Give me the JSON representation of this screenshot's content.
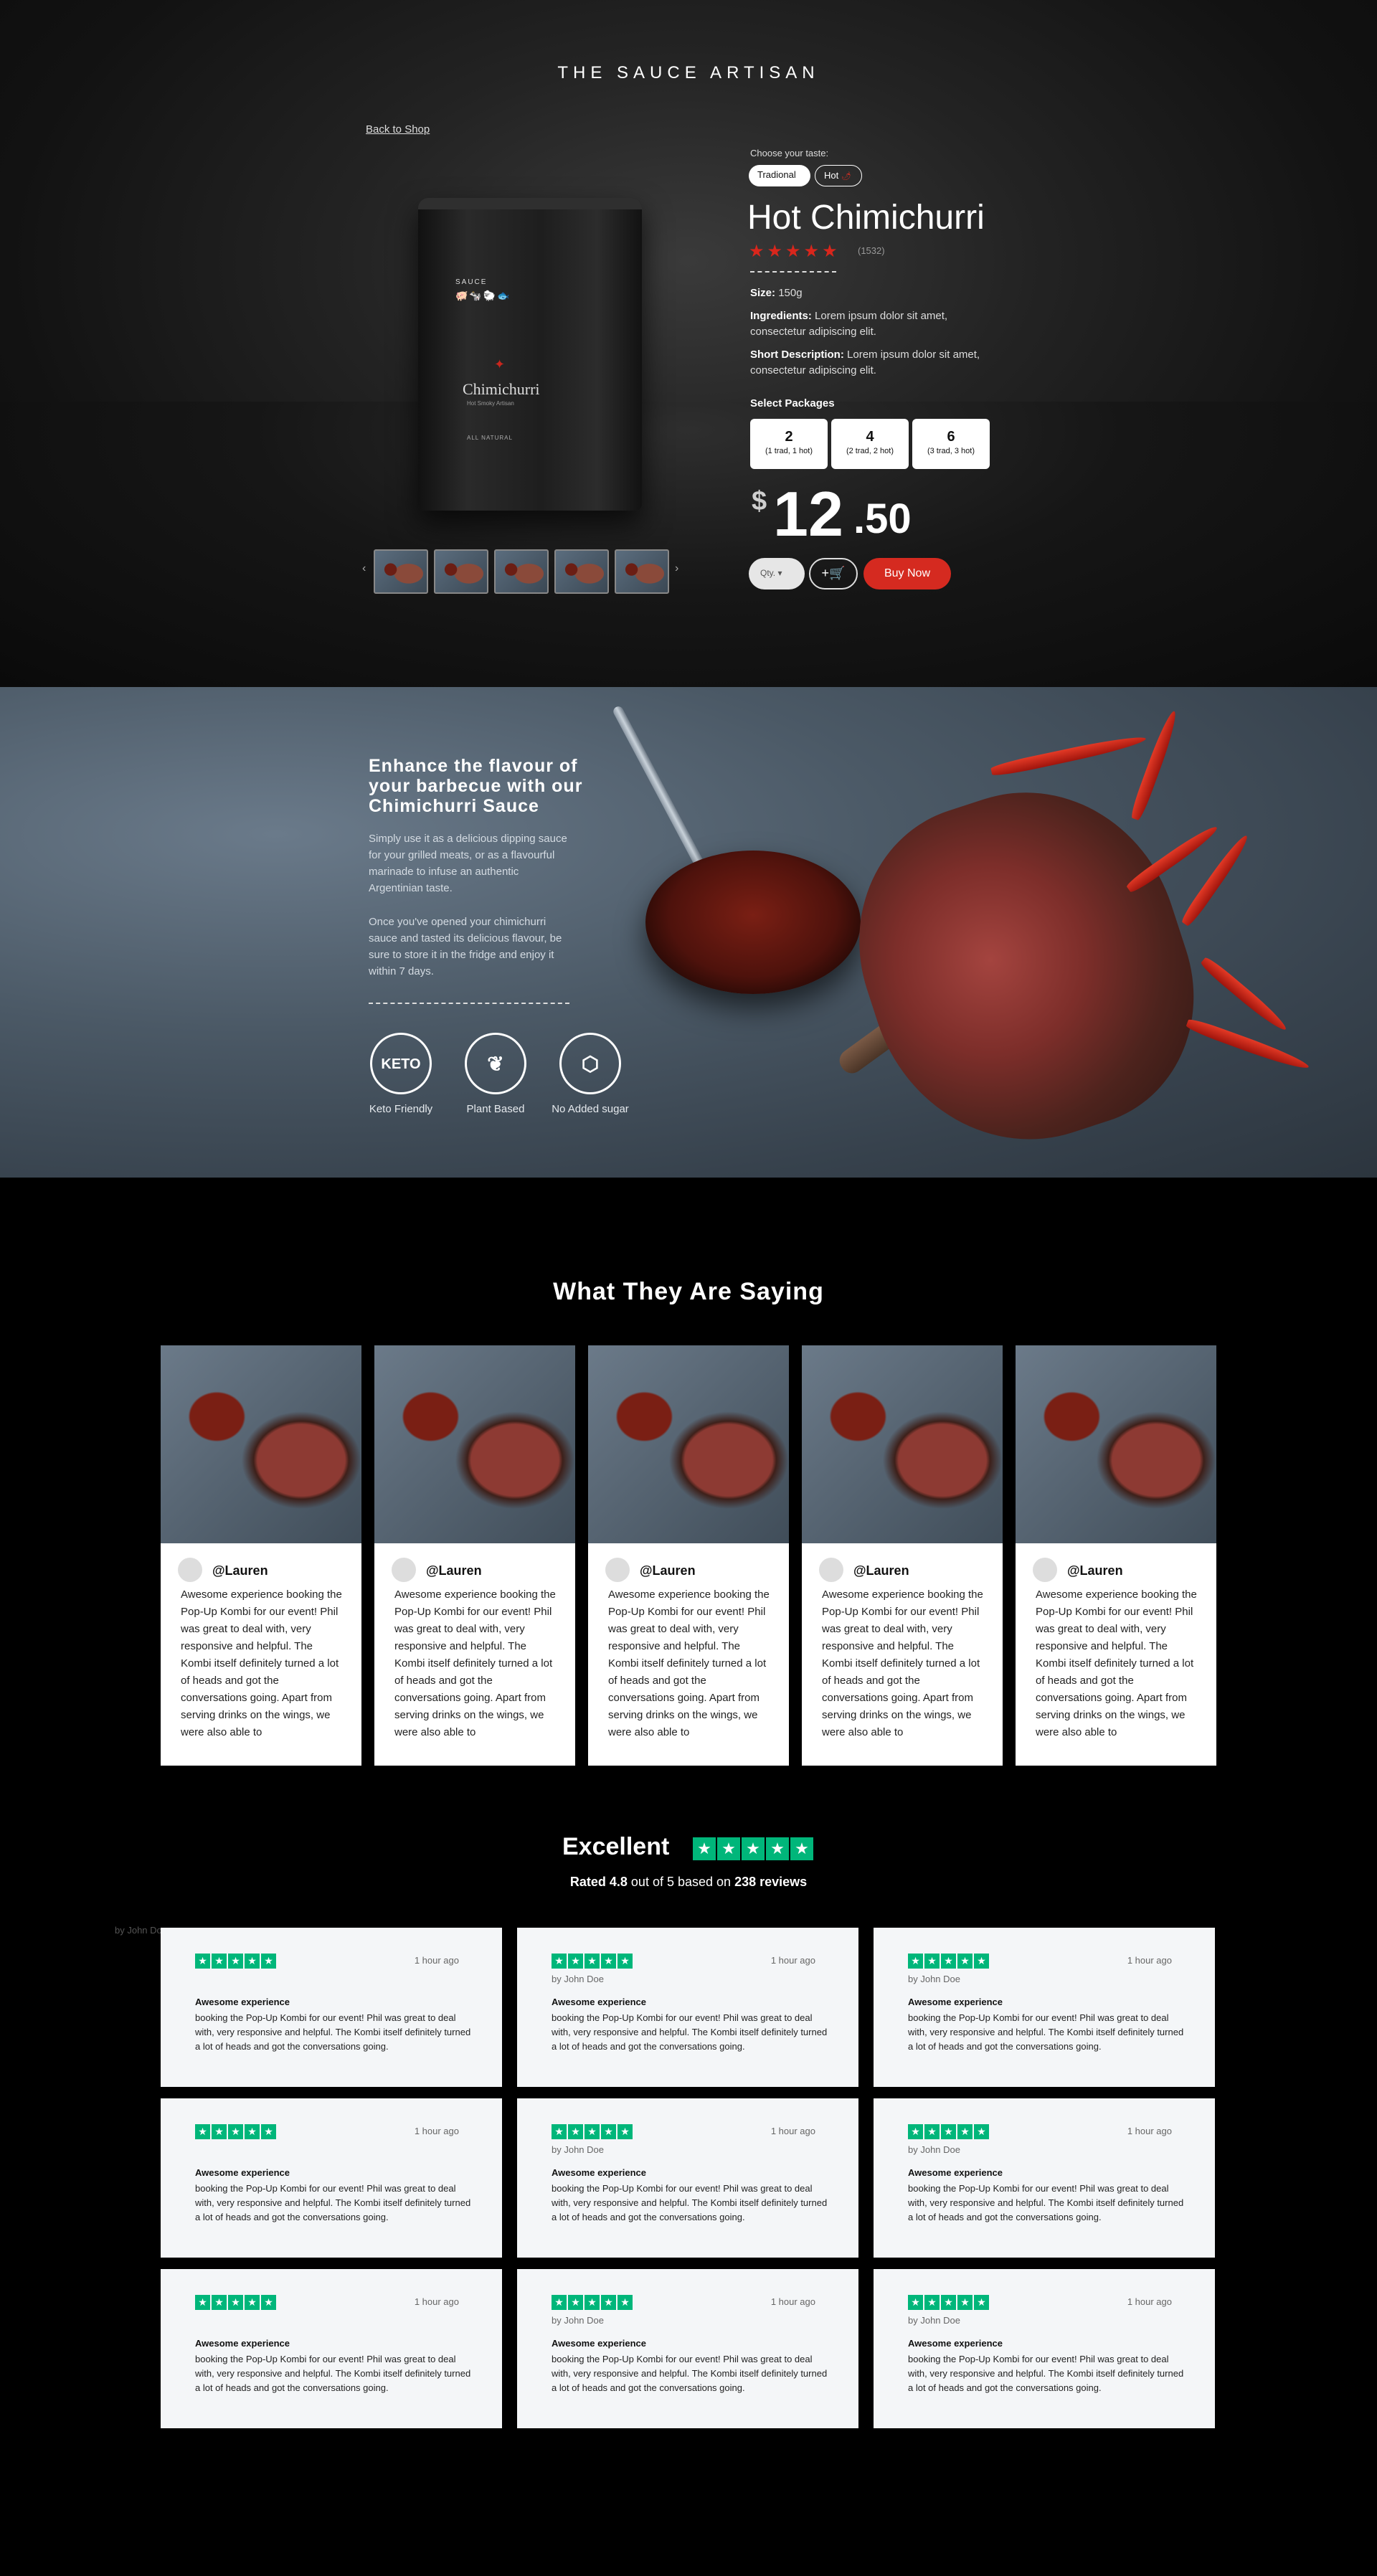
{
  "header": {
    "brand": "THE SAUCE ARTISAN",
    "back_link": "Back to Shop"
  },
  "packshot": {
    "sauce_label": "SAUCE",
    "animals": "🐖🐄🐑🐟",
    "name": "Chimichurri",
    "subtitle": "Hot Smoky Artisan",
    "natural": "ALL NATURAL"
  },
  "product": {
    "taste_label": "Choose your taste:",
    "tastes": [
      "Tradional",
      "Hot"
    ],
    "title": "Hot Chimichurri",
    "rating_stars": "★★★★★",
    "rating_count": "(1532)",
    "size_label": "Size:",
    "size_value": "150g",
    "ingredients_label": "Ingredients:",
    "ingredients_value": "Lorem ipsum dolor sit amet, consectetur adipiscing elit.",
    "short_label": "Short Description:",
    "short_value": "Lorem ipsum dolor sit amet, consectetur adipiscing elit.",
    "packages_label": "Select Packages",
    "packages": [
      {
        "n": "2",
        "d": "(1 trad, 1 hot)"
      },
      {
        "n": "4",
        "d": "(2 trad, 2 hot)"
      },
      {
        "n": "6",
        "d": "(3 trad, 3 hot)"
      }
    ],
    "price_currency": "$",
    "price_whole": "12",
    "price_cents": ".50",
    "qty_label": "Qty.",
    "qty_arrow": "▾",
    "cart_icon": "+🛒",
    "buy_label": "Buy Now"
  },
  "feature": {
    "title": "Enhance the flavour of your barbecue with our Chimichurri Sauce",
    "p1": "Simply use it as a delicious dipping sauce for your grilled meats, or as a flavourful marinade to infuse an authentic Argentinian taste.",
    "p2": "Once you've opened your chimichurri sauce and tasted its delicious flavour, be sure to store it in the fridge and enjoy it within 7 days.",
    "badges": [
      {
        "glyph": "KETO",
        "label": "Keto Friendly",
        "icon": "keto-icon"
      },
      {
        "glyph": "❦",
        "label": "Plant Based",
        "icon": "leaf-icon"
      },
      {
        "glyph": "⬡",
        "label": "No Added sugar",
        "icon": "sugar-cube-icon"
      }
    ]
  },
  "testimonials": {
    "title": "What They Are Saying",
    "items": [
      {
        "handle": "@Lauren",
        "text": "Awesome experience booking the Pop-Up Kombi for our event! Phil was great to deal with, very responsive and helpful. The Kombi itself definitely turned a lot of heads and got the conversations going. Apart from serving drinks on the wings, we were also able to"
      },
      {
        "handle": "@Lauren",
        "text": "Awesome experience booking the Pop-Up Kombi for our event! Phil was great to deal with, very responsive and helpful. The Kombi itself definitely turned a lot of heads and got the conversations going. Apart from serving drinks on the wings, we were also able to"
      },
      {
        "handle": "@Lauren",
        "text": "Awesome experience booking the Pop-Up Kombi for our event! Phil was great to deal with, very responsive and helpful. The Kombi itself definitely turned a lot of heads and got the conversations going. Apart from serving drinks on the wings, we were also able to"
      },
      {
        "handle": "@Lauren",
        "text": "Awesome experience booking the Pop-Up Kombi for our event! Phil was great to deal with, very responsive and helpful. The Kombi itself definitely turned a lot of heads and got the conversations going. Apart from serving drinks on the wings, we were also able to"
      },
      {
        "handle": "@Lauren",
        "text": "Awesome experience booking the Pop-Up Kombi for our event! Phil was great to deal with, very responsive and helpful. The Kombi itself definitely turned a lot of heads and got the conversations going. Apart from serving drinks on the wings, we were also able to"
      }
    ]
  },
  "reviews": {
    "excellent": "Excellent",
    "rated_prefix": "Rated",
    "rated_score": "4.8",
    "rated_mid": "out of 5 based on",
    "rated_count": "238 reviews",
    "stray_by": "by John Doe",
    "star_glyph": "★",
    "items": [
      {
        "ago": "1 hour ago",
        "by": "",
        "title": "Awesome experience",
        "text": "booking the Pop-Up Kombi for our event! Phil was great to deal with, very responsive and helpful. The Kombi itself definitely turned a lot of heads and got the conversations going."
      },
      {
        "ago": "1 hour ago",
        "by": "by John Doe",
        "title": "Awesome experience",
        "text": "booking the Pop-Up Kombi for our event! Phil was great to deal with, very responsive and helpful. The Kombi itself definitely turned a lot of heads and got the conversations going."
      },
      {
        "ago": "1 hour ago",
        "by": "by John Doe",
        "title": "Awesome experience",
        "text": "booking the Pop-Up Kombi for our event! Phil was great to deal with, very responsive and helpful. The Kombi itself definitely turned a lot of heads and got the conversations going."
      },
      {
        "ago": "1 hour ago",
        "by": "",
        "title": "Awesome experience",
        "text": "booking the Pop-Up Kombi for our event! Phil was great to deal with, very responsive and helpful. The Kombi itself definitely turned a lot of heads and got the conversations going."
      },
      {
        "ago": "1 hour ago",
        "by": "by John Doe",
        "title": "Awesome experience",
        "text": "booking the Pop-Up Kombi for our event! Phil was great to deal with, very responsive and helpful. The Kombi itself definitely turned a lot of heads and got the conversations going."
      },
      {
        "ago": "1 hour ago",
        "by": "by John Doe",
        "title": "Awesome experience",
        "text": "booking the Pop-Up Kombi for our event! Phil was great to deal with, very responsive and helpful. The Kombi itself definitely turned a lot of heads and got the conversations going."
      },
      {
        "ago": "1 hour ago",
        "by": "",
        "title": "Awesome experience",
        "text": "booking the Pop-Up Kombi for our event! Phil was great to deal with, very responsive and helpful. The Kombi itself definitely turned a lot of heads and got the conversations going."
      },
      {
        "ago": "1 hour ago",
        "by": "by John Doe",
        "title": "Awesome experience",
        "text": "booking the Pop-Up Kombi for our event! Phil was great to deal with, very responsive and helpful. The Kombi itself definitely turned a lot of heads and got the conversations going."
      },
      {
        "ago": "1 hour ago",
        "by": "by John Doe",
        "title": "Awesome experience",
        "text": "booking the Pop-Up Kombi for our event! Phil was great to deal with, very responsive and helpful. The Kombi itself definitely turned a lot of heads and got the conversations going."
      }
    ]
  },
  "colors": {
    "accent_red": "#d52a20",
    "trustpilot_green": "#00b67a"
  }
}
